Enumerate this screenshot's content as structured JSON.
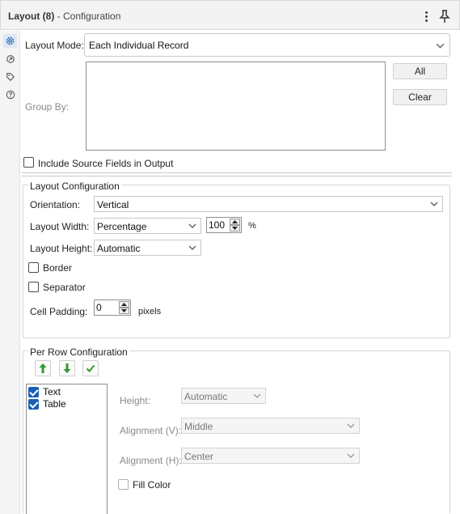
{
  "header": {
    "tool_name": "Layout (8)",
    "section": " - Configuration"
  },
  "rail": {
    "icons": [
      "gear-icon",
      "gear-arrow-icon",
      "tag-icon",
      "help-icon"
    ]
  },
  "layout_mode": {
    "label": "Layout Mode:",
    "value": "Each Individual Record"
  },
  "group_by": {
    "label": "Group By:",
    "all_button": "All",
    "clear_button": "Clear"
  },
  "include_source": {
    "label": "Include Source Fields in Output",
    "checked": false
  },
  "layout_config": {
    "title": "Layout Configuration",
    "orientation_label": "Orientation:",
    "orientation_value": "Vertical",
    "width_label": "Layout Width:",
    "width_mode": "Percentage",
    "width_value": "100",
    "width_unit": "%",
    "height_label": "Layout Height:",
    "height_value": "Automatic",
    "border_label": "Border",
    "border_checked": false,
    "separator_label": "Separator",
    "separator_checked": false,
    "padding_label": "Cell Padding:",
    "padding_value": "0",
    "padding_unit": "pixels"
  },
  "per_row": {
    "title": "Per Row Configuration",
    "toolbar": [
      "move-up-icon",
      "move-down-icon",
      "check-icon"
    ],
    "items": [
      {
        "label": "Text",
        "checked": true
      },
      {
        "label": "Table",
        "checked": true
      }
    ],
    "height_label": "Height:",
    "height_value": "Automatic",
    "align_v_label": "Alignment (V):",
    "align_v_value": "Middle",
    "align_h_label": "Alignment (H):",
    "align_h_value": "Center",
    "fill_color_label": "Fill Color",
    "fill_color_checked": false
  },
  "colors": {
    "accent": "#1a5fb4",
    "green_arrow": "#2e9a2e"
  }
}
